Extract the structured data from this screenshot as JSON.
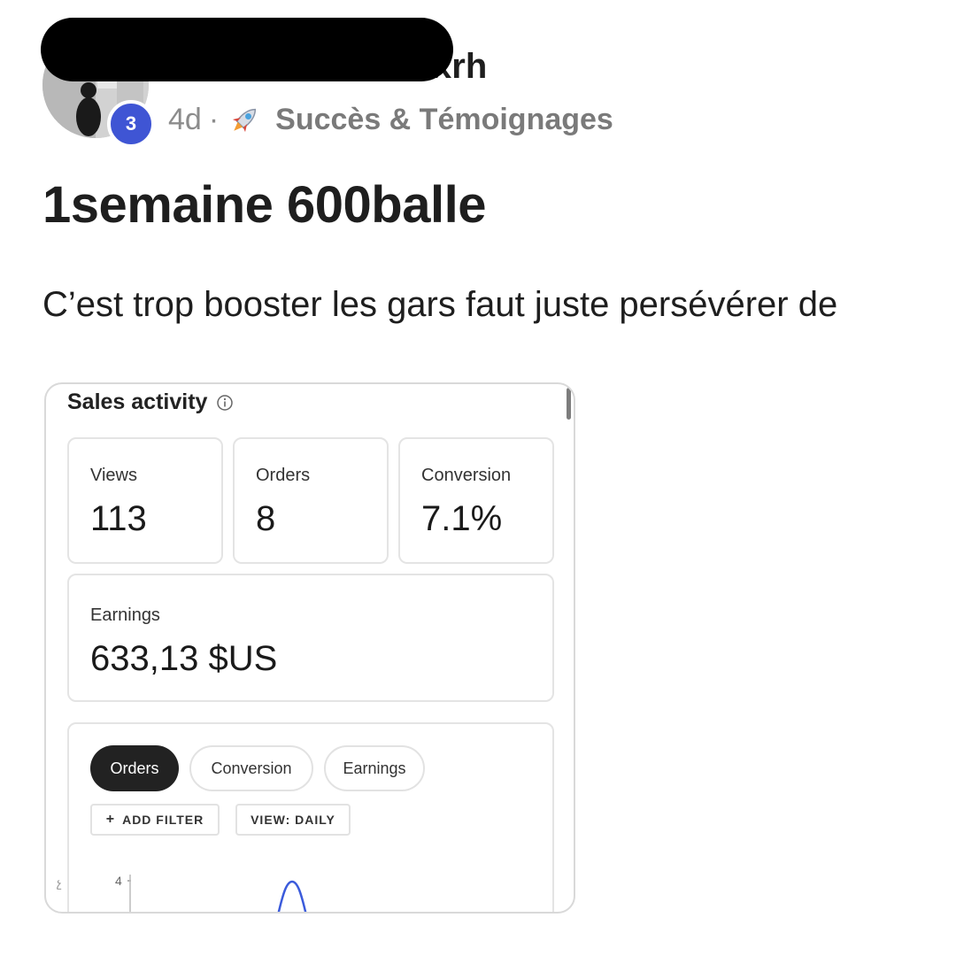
{
  "post": {
    "author_visible_suffix": "xrh",
    "level": "3",
    "age": "4d",
    "separator": "·",
    "category_icon": "rocket-icon",
    "category": "Succès & Témoignages",
    "title": "1semaine 600balle",
    "body": "C’est trop booster les gars faut juste persévérer de"
  },
  "dashboard": {
    "title": "Sales activity",
    "stats": {
      "views_label": "Views",
      "views_value": "113",
      "orders_label": "Orders",
      "orders_value": "8",
      "conversion_label": "Conversion",
      "conversion_value": "7.1%",
      "earnings_label": "Earnings",
      "earnings_value": "633,13 $US"
    },
    "tabs": [
      "Orders",
      "Conversion",
      "Earnings"
    ],
    "active_tab": "Orders",
    "add_filter_label": "ADD FILTER",
    "view_label": "VIEW: DAILY",
    "chart_tick": "4"
  },
  "colors": {
    "level_badge": "#3f55d4",
    "chart_line": "#3b5bdb",
    "active_chip": "#222222"
  }
}
